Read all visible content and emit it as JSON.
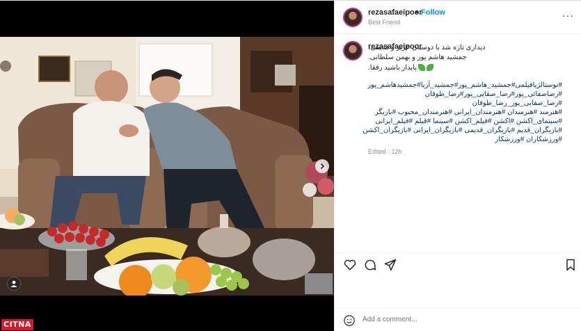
{
  "post": {
    "username": "rezasafaeipoor",
    "follow_label": "Follow",
    "dot": "•",
    "subtitle": "Best Friend",
    "more_label": "···",
    "caption": {
      "line1": "دیداری تازه شد با دوستان عزیز و قدیمی،",
      "line2": "جمشید هاشم پور و بهمن سلطانی.",
      "line3": "پایدار باشید رفقا."
    },
    "hashtags": [
      "#نوستالژیافیلمی#جمشید_هاشم_پور#جمشید_آریا#جمشیدهاشم_پور",
      "#رضاصفائی_پور#رضا_صفایی_پور#رضا_طوفان",
      "#رضا_صفایی_پور_رضا_طوفان",
      "#هنرمند #هنرمندان #هنرمندان_ایرانی #هنرمندان_محبوب #بازیگر",
      "#سینمای_اکشن #اکشن #فیلم_اکشن #سینما #فیلم #فیلم_ایرانی",
      "#بازیگران_قدیم #بازیگران_قدیمی #بازیگران_ایرانی #بازیگران_اکشن",
      "#ورزشکاران #ورزشکار"
    ],
    "edited": "Edited · 12h",
    "comment_placeholder": "Add a comment..."
  },
  "watermark": "CITNA",
  "icons": {
    "like": "heart-icon",
    "comment": "comment-icon",
    "share": "send-icon",
    "save": "bookmark-icon",
    "emoji": "emoji-icon",
    "tags": "user-tag-icon",
    "next": "chevron-right-icon"
  },
  "colors": {
    "link": "#0095f6",
    "hashtag": "#00376b",
    "watermark": "#d7182a"
  }
}
